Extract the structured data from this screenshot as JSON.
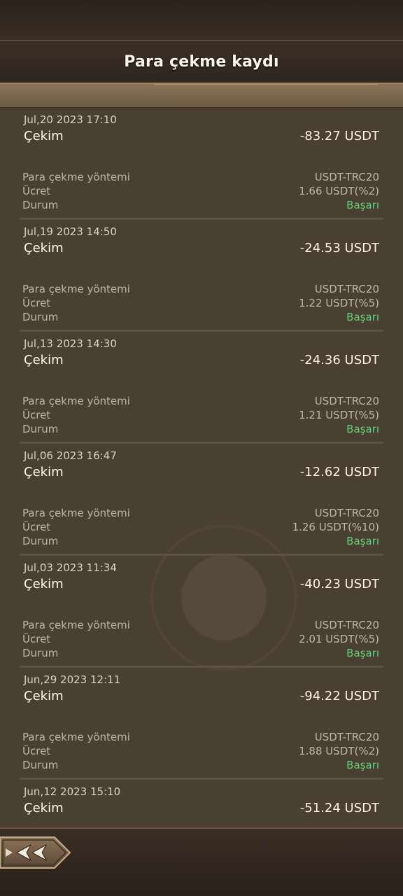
{
  "header": {
    "title": "Para çekme kaydı"
  },
  "labels": {
    "method": "Para çekme yöntemi",
    "fee": "Ücret",
    "status": "Durum"
  },
  "records": [
    {
      "date": "Jul,20 2023 17:10",
      "type": "Çekim",
      "amount": "-83.27 USDT",
      "method": "USDT-TRC20",
      "fee": "1.66 USDT(%2)",
      "status": "Başarı"
    },
    {
      "date": "Jul,19 2023 14:50",
      "type": "Çekim",
      "amount": "-24.53 USDT",
      "method": "USDT-TRC20",
      "fee": "1.22 USDT(%5)",
      "status": "Başarı"
    },
    {
      "date": "Jul,13 2023 14:30",
      "type": "Çekim",
      "amount": "-24.36 USDT",
      "method": "USDT-TRC20",
      "fee": "1.21 USDT(%5)",
      "status": "Başarı"
    },
    {
      "date": "Jul,06 2023 16:47",
      "type": "Çekim",
      "amount": "-12.62 USDT",
      "method": "USDT-TRC20",
      "fee": "1.26 USDT(%10)",
      "status": "Başarı"
    },
    {
      "date": "Jul,03 2023 11:34",
      "type": "Çekim",
      "amount": "-40.23 USDT",
      "method": "USDT-TRC20",
      "fee": "2.01 USDT(%5)",
      "status": "Başarı"
    },
    {
      "date": "Jun,29 2023 12:11",
      "type": "Çekim",
      "amount": "-94.22 USDT",
      "method": "USDT-TRC20",
      "fee": "1.88 USDT(%2)",
      "status": "Başarı"
    },
    {
      "date": "Jun,12 2023 15:10",
      "type": "Çekim",
      "amount": "-51.24 USDT"
    }
  ],
  "icons": {
    "back": "double-chevron-left-icon"
  },
  "colors": {
    "success": "#5fd07a",
    "background": "#4a3f33"
  }
}
